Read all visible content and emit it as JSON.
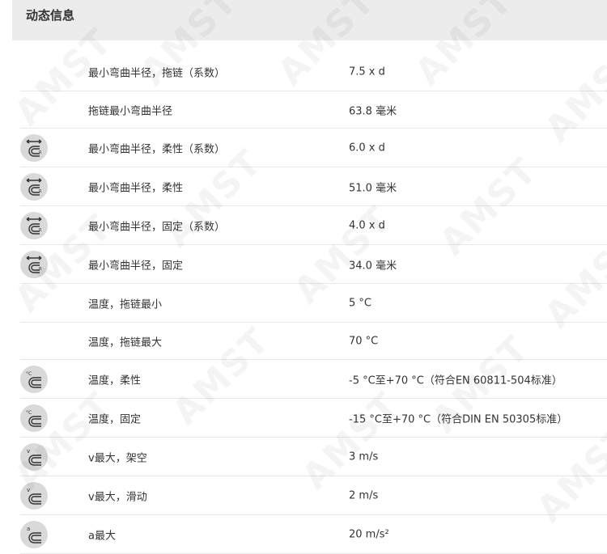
{
  "header": {
    "title": "动态信息"
  },
  "rows": [
    {
      "label": "最小弯曲半径，拖链（系数）",
      "value": "7.5 x d",
      "icon": ""
    },
    {
      "label": "拖链最小弯曲半径",
      "value": "63.8 毫米",
      "icon": ""
    },
    {
      "label": "最小弯曲半径，柔性（系数）",
      "value": "6.0 x d",
      "icon": "bend-radius-icon"
    },
    {
      "label": "最小弯曲半径，柔性",
      "value": "51.0 毫米",
      "icon": "bend-radius-icon"
    },
    {
      "label": "最小弯曲半径，固定（系数）",
      "value": "4.0 x d",
      "icon": "bend-radius-icon"
    },
    {
      "label": "最小弯曲半径，固定",
      "value": "34.0 毫米",
      "icon": "bend-radius-icon"
    },
    {
      "label": "温度，拖链最小",
      "value": "5 °C",
      "icon": ""
    },
    {
      "label": "温度，拖链最大",
      "value": "70 °C",
      "icon": ""
    },
    {
      "label": "温度，柔性",
      "value": "-5 °C至+70 °C（符合EN 60811-504标准）",
      "icon": "temperature-cable-icon"
    },
    {
      "label": "温度，固定",
      "value": "-15 °C至+70 °C（符合DIN EN 50305标准）",
      "icon": "temperature-cable-icon"
    },
    {
      "label": "v最大，架空",
      "value": "3 m/s",
      "icon": "velocity-cable-icon"
    },
    {
      "label": "v最大，滑动",
      "value": "2 m/s",
      "icon": "velocity-cable-icon"
    },
    {
      "label": "a最大",
      "value": "20 m/s²",
      "icon": "acceleration-cable-icon"
    }
  ],
  "watermark": {
    "text": "AMST"
  }
}
